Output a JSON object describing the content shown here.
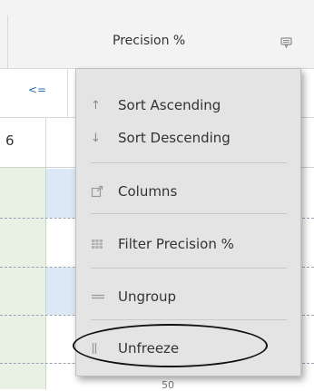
{
  "grid": {
    "column_header": "Precision %",
    "filter_operator": "<=",
    "row_value": "6",
    "bottom_peek": "50"
  },
  "menu": {
    "items": [
      {
        "icon": "arrow-up-icon",
        "label": "Sort Ascending"
      },
      {
        "icon": "arrow-down-icon",
        "label": "Sort Descending"
      },
      {
        "icon": "columns-icon",
        "label": "Columns"
      },
      {
        "icon": "table-filter-icon",
        "label": "Filter Precision %"
      },
      {
        "icon": "ungroup-icon",
        "label": "Ungroup"
      },
      {
        "icon": "unfreeze-icon",
        "label": "Unfreeze"
      }
    ]
  },
  "annotation": {
    "highlight_color": "#111111"
  }
}
